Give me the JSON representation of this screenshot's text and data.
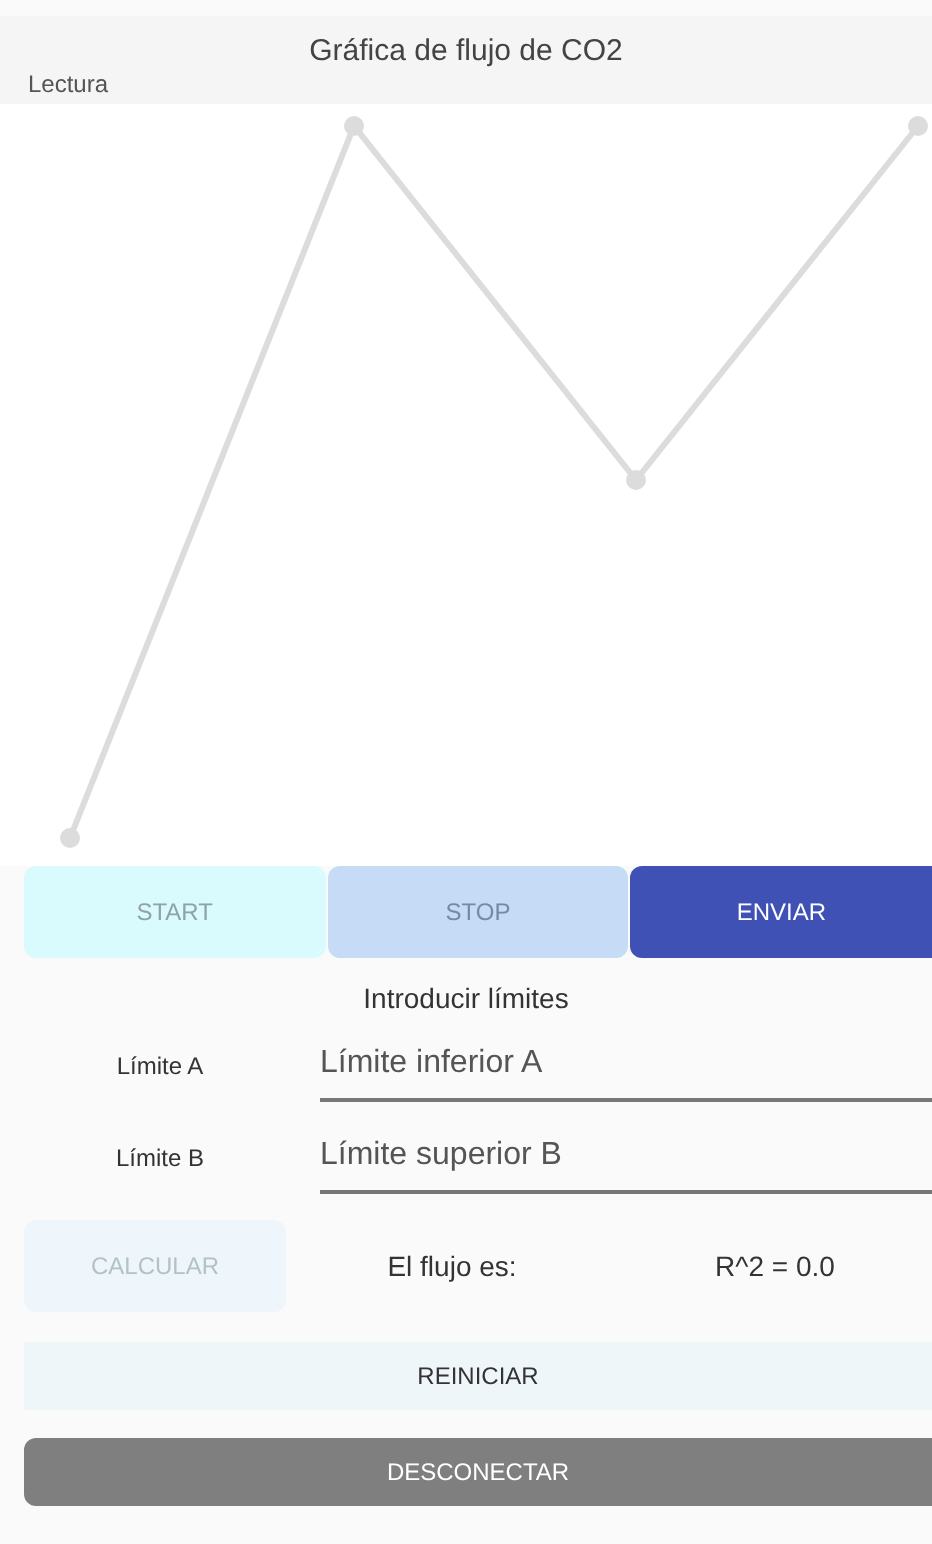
{
  "chart": {
    "title": "Gráfica de flujo de CO2",
    "series_label": "Lectura"
  },
  "actions": [
    {
      "label": "START",
      "disabled": true,
      "kind": "start"
    },
    {
      "label": "STOP",
      "disabled": true,
      "kind": "stop"
    },
    {
      "label": "ENVIAR",
      "disabled": false,
      "kind": "send"
    }
  ],
  "limits": {
    "heading": "Introducir límites",
    "fields": [
      {
        "label": "Límite A",
        "placeholder": "Límite inferior A"
      },
      {
        "label": "Límite B",
        "placeholder": "Límite superior B"
      }
    ]
  },
  "calculate": {
    "label": "CALCULAR",
    "disabled": true
  },
  "result": {
    "flow": "El flujo es:",
    "r2": "R^2 = 0.0"
  },
  "reset": {
    "label": "REINICIAR"
  },
  "disconnect": {
    "label": "DESCONECTAR"
  }
}
